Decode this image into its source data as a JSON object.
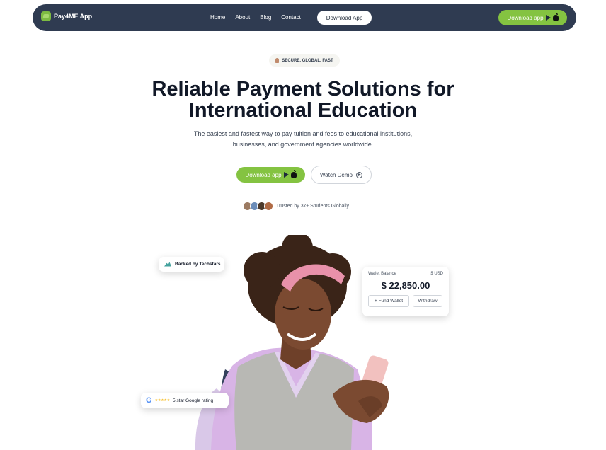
{
  "nav": {
    "brand": "Pay4ME App",
    "links": [
      "Home",
      "About",
      "Blog",
      "Contact"
    ],
    "download_label": "Download App",
    "cta_label": "Download app"
  },
  "hero": {
    "badge": "SECURE. GLOBAL. FAST",
    "title_line1": "Reliable Payment Solutions for",
    "title_line2": "International Education",
    "subtitle_line1": "The easiest and fastest way to pay tuition and fees to educational institutions,",
    "subtitle_line2": "businesses, and government agencies worldwide.",
    "primary_label": "Download app",
    "demo_label": "Watch Demo",
    "trust_text": "Trusted by 3k+ Students Globally"
  },
  "cards": {
    "techstars": "Backed by Techstars",
    "wallet": {
      "label": "Wallet Balance",
      "currency": "$ USD",
      "amount": "$ 22,850.00",
      "fund_label": "+ Fund Wallet",
      "withdraw_label": "Withdraw"
    },
    "google": {
      "stars": "★★★★★",
      "text": "5 star Google rating"
    }
  },
  "colors": {
    "nav_bg": "#2f3b51",
    "accent_green": "#84c341",
    "headband_pink": "#e891aa",
    "shirt_lilac": "#d8b4e6",
    "vest_gray": "#b8b8b4",
    "skin": "#7b4a31"
  }
}
